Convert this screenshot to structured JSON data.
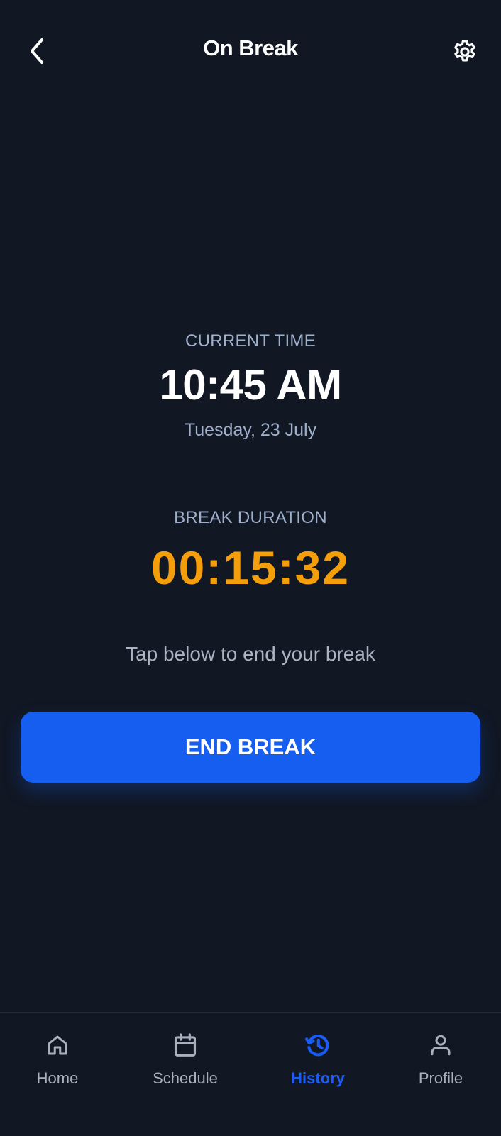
{
  "header": {
    "title": "On Break",
    "back_icon": "chevron-left-icon",
    "settings_icon": "gear-icon"
  },
  "clock": {
    "label": "CURRENT TIME",
    "time": "10:45 AM",
    "date": "Tuesday, 23 July"
  },
  "break": {
    "label": "BREAK DURATION",
    "duration": "00:15:32",
    "hint": "Tap below to end your break",
    "end_button_label": "END BREAK"
  },
  "nav": {
    "items": [
      {
        "label": "Home",
        "icon": "home-icon",
        "active": false
      },
      {
        "label": "Schedule",
        "icon": "calendar-icon",
        "active": false
      },
      {
        "label": "History",
        "icon": "history-icon",
        "active": true
      },
      {
        "label": "Profile",
        "icon": "user-icon",
        "active": false
      }
    ]
  },
  "colors": {
    "background": "#111723",
    "accent": "#155EF0",
    "duration": "#F59E0B",
    "muted_label": "#9FB0CC",
    "nav_inactive": "#A8B0BD",
    "nav_active": "#1A5CF5"
  }
}
